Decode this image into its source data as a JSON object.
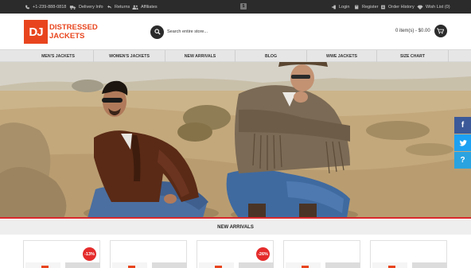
{
  "topbar": {
    "phone": "+1-239-888-0818",
    "delivery": "Delivery Info",
    "returns": "Returns",
    "affiliates": "Affiliates",
    "login": "Login",
    "register": "Register",
    "order_history": "Order History",
    "wishlist": "Wish List (0)"
  },
  "logo": {
    "mark": "DJ",
    "line1": "DISTRESSED",
    "line2": "JACKETS"
  },
  "search": {
    "placeholder": "Search entire store..."
  },
  "cart": {
    "summary": "0 item(s) - $0.00"
  },
  "nav": {
    "items": [
      "MEN'S JACKETS",
      "WOMEN'S JACKETS",
      "NEW ARRIVALS",
      "BLOG",
      "WWE JACKETS",
      "SIZE CHART"
    ]
  },
  "social": {
    "facebook": "f",
    "help": "?"
  },
  "new_arrivals": {
    "title": "NEW ARRIVALS",
    "products": [
      {
        "badge": "-13%"
      },
      {
        "badge": ""
      },
      {
        "badge": "-26%"
      },
      {
        "badge": ""
      },
      {
        "badge": ""
      }
    ]
  },
  "colors": {
    "accent": "#e8451e",
    "topbar_bg": "#2b2b2b",
    "nav_bg": "#e6e6e6",
    "sale_badge": "#e52b2b",
    "facebook": "#3b5998",
    "twitter": "#1da1f2",
    "help": "#2aa3e0"
  }
}
